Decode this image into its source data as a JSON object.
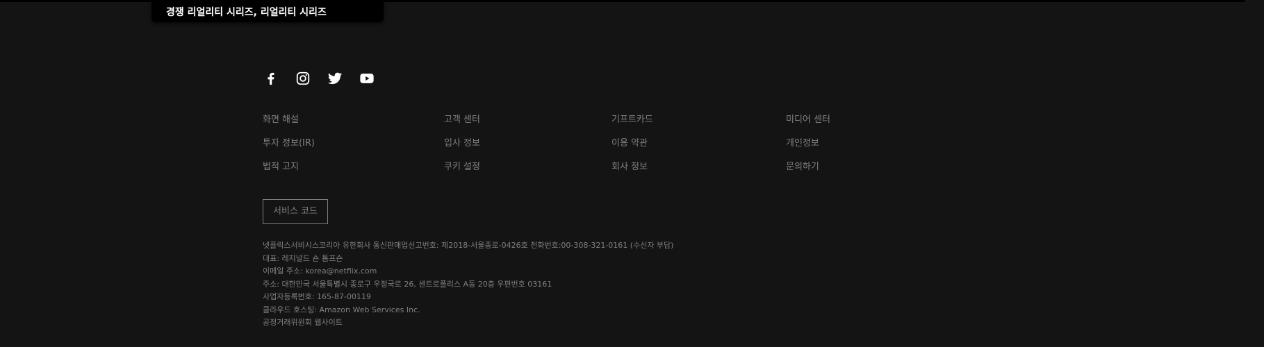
{
  "tooltip": {
    "text": "경쟁 리얼리티 시리즈, 리얼리티 시리즈"
  },
  "social": {
    "items": [
      {
        "icon": "facebook-icon"
      },
      {
        "icon": "instagram-icon"
      },
      {
        "icon": "twitter-icon"
      },
      {
        "icon": "youtube-icon"
      }
    ]
  },
  "links": {
    "col1": [
      "화면 해설",
      "투자 정보(IR)",
      "법적 고지"
    ],
    "col2": [
      "고객 센터",
      "입사 정보",
      "쿠키 설정"
    ],
    "col3": [
      "기프트카드",
      "이용 약관",
      "회사 정보"
    ],
    "col4": [
      "미디어 센터",
      "개인정보",
      "문의하기"
    ]
  },
  "service_code": {
    "label": "서비스 코드"
  },
  "legal": {
    "lines": [
      "넷플릭스서비시스코리아 유한회사 통신판매업신고번호: 제2018-서울종로-0426호 전화번호:00-308-321-0161 (수신자 부담)",
      "대표: 레지널드 숀 톰프슨",
      "이메일 주소: korea@netflix.com",
      "주소: 대한민국 서울특별시 종로구 우정국로 26, 센트로폴리스 A동 20층 우편번호 03161",
      "사업자등록번호: 165-87-00119",
      "클라우드 호스팅: Amazon Web Services Inc.",
      "공정거래위원회 웹사이트"
    ]
  },
  "colors": {
    "background": "#141414",
    "text": "#808080",
    "icon": "#ffffff"
  }
}
